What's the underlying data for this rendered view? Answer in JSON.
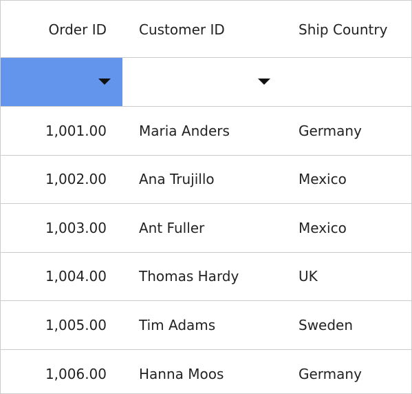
{
  "columns": {
    "order_id": "Order ID",
    "customer_id": "Customer ID",
    "ship_country": "Ship Country"
  },
  "filter": {
    "order_id_arrow": "dropdown-arrow-icon",
    "customer_id_arrow": "dropdown-arrow-icon",
    "active_color": "#6495ED"
  },
  "rows": [
    {
      "order_id": "1,001.00",
      "customer_id": "Maria Anders",
      "ship_country": "Germany"
    },
    {
      "order_id": "1,002.00",
      "customer_id": "Ana Trujillo",
      "ship_country": "Mexico"
    },
    {
      "order_id": "1,003.00",
      "customer_id": "Ant Fuller",
      "ship_country": "Mexico"
    },
    {
      "order_id": "1,004.00",
      "customer_id": "Thomas Hardy",
      "ship_country": "UK"
    },
    {
      "order_id": "1,005.00",
      "customer_id": "Tim Adams",
      "ship_country": "Sweden"
    },
    {
      "order_id": "1,006.00",
      "customer_id": "Hanna Moos",
      "ship_country": "Germany"
    }
  ]
}
